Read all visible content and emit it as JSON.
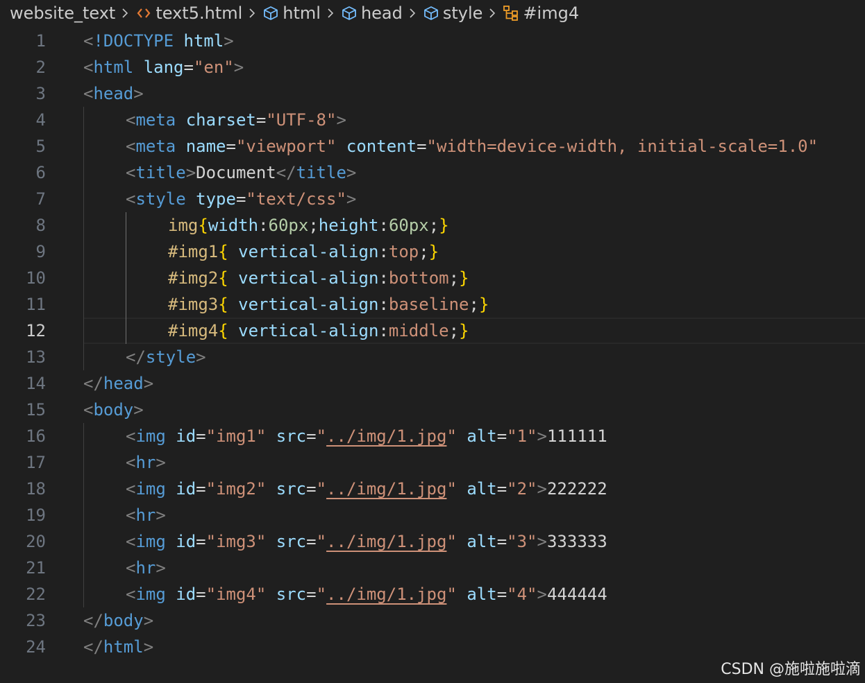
{
  "breadcrumb": [
    {
      "label": "website_text",
      "icon": "none"
    },
    {
      "label": "text5.html",
      "icon": "html-file-icon"
    },
    {
      "label": "html",
      "icon": "cube-icon"
    },
    {
      "label": "head",
      "icon": "cube-icon"
    },
    {
      "label": "style",
      "icon": "cube-icon"
    },
    {
      "label": "#img4",
      "icon": "css-selector-icon"
    }
  ],
  "editor": {
    "current_line": 12,
    "lines": [
      {
        "n": "1",
        "indent": 0,
        "tokens": [
          [
            "<",
            "punct"
          ],
          [
            "!DOCTYPE",
            "tag"
          ],
          [
            " ",
            "text"
          ],
          [
            "html",
            "attr"
          ],
          [
            ">",
            "punct"
          ]
        ]
      },
      {
        "n": "2",
        "indent": 0,
        "tokens": [
          [
            "<",
            "punct"
          ],
          [
            "html",
            "tag"
          ],
          [
            " ",
            "text"
          ],
          [
            "lang",
            "attr"
          ],
          [
            "=",
            "eq"
          ],
          [
            "\"en\"",
            "str"
          ],
          [
            ">",
            "punct"
          ]
        ]
      },
      {
        "n": "3",
        "indent": 0,
        "tokens": [
          [
            "<",
            "punct"
          ],
          [
            "head",
            "tag"
          ],
          [
            ">",
            "punct"
          ]
        ]
      },
      {
        "n": "4",
        "indent": 1,
        "tokens": [
          [
            "<",
            "punct"
          ],
          [
            "meta",
            "tag"
          ],
          [
            " ",
            "text"
          ],
          [
            "charset",
            "attr"
          ],
          [
            "=",
            "eq"
          ],
          [
            "\"UTF-8\"",
            "str"
          ],
          [
            ">",
            "punct"
          ]
        ]
      },
      {
        "n": "5",
        "indent": 1,
        "tokens": [
          [
            "<",
            "punct"
          ],
          [
            "meta",
            "tag"
          ],
          [
            " ",
            "text"
          ],
          [
            "name",
            "attr"
          ],
          [
            "=",
            "eq"
          ],
          [
            "\"viewport\"",
            "str"
          ],
          [
            " ",
            "text"
          ],
          [
            "content",
            "attr"
          ],
          [
            "=",
            "eq"
          ],
          [
            "\"width=device-width, initial-scale=1.0\"",
            "str"
          ]
        ]
      },
      {
        "n": "6",
        "indent": 1,
        "tokens": [
          [
            "<",
            "punct"
          ],
          [
            "title",
            "tag"
          ],
          [
            ">",
            "punct"
          ],
          [
            "Document",
            "text"
          ],
          [
            "</",
            "punct"
          ],
          [
            "title",
            "tag"
          ],
          [
            ">",
            "punct"
          ]
        ]
      },
      {
        "n": "7",
        "indent": 1,
        "tokens": [
          [
            "<",
            "punct"
          ],
          [
            "style",
            "tag"
          ],
          [
            " ",
            "text"
          ],
          [
            "type",
            "attr"
          ],
          [
            "=",
            "eq"
          ],
          [
            "\"text/css\"",
            "str"
          ],
          [
            ">",
            "punct"
          ]
        ]
      },
      {
        "n": "8",
        "indent": 2,
        "tokens": [
          [
            "img",
            "sel"
          ],
          [
            "{",
            "brace"
          ],
          [
            "width",
            "prop"
          ],
          [
            ":",
            "text"
          ],
          [
            "60",
            "num"
          ],
          [
            "px",
            "unit"
          ],
          [
            ";",
            "text"
          ],
          [
            "height",
            "prop"
          ],
          [
            ":",
            "text"
          ],
          [
            "60",
            "num"
          ],
          [
            "px",
            "unit"
          ],
          [
            ";",
            "text"
          ],
          [
            "}",
            "brace"
          ]
        ]
      },
      {
        "n": "9",
        "indent": 2,
        "tokens": [
          [
            "#img1",
            "sel"
          ],
          [
            "{",
            "brace"
          ],
          [
            " ",
            "text"
          ],
          [
            "vertical-align",
            "prop"
          ],
          [
            ":",
            "text"
          ],
          [
            "top",
            "kw"
          ],
          [
            ";",
            "text"
          ],
          [
            "}",
            "brace"
          ]
        ]
      },
      {
        "n": "10",
        "indent": 2,
        "tokens": [
          [
            "#img2",
            "sel"
          ],
          [
            "{",
            "brace"
          ],
          [
            " ",
            "text"
          ],
          [
            "vertical-align",
            "prop"
          ],
          [
            ":",
            "text"
          ],
          [
            "bottom",
            "kw"
          ],
          [
            ";",
            "text"
          ],
          [
            "}",
            "brace"
          ]
        ]
      },
      {
        "n": "11",
        "indent": 2,
        "tokens": [
          [
            "#img3",
            "sel"
          ],
          [
            "{",
            "brace"
          ],
          [
            " ",
            "text"
          ],
          [
            "vertical-align",
            "prop"
          ],
          [
            ":",
            "text"
          ],
          [
            "baseline",
            "kw"
          ],
          [
            ";",
            "text"
          ],
          [
            "}",
            "brace"
          ]
        ]
      },
      {
        "n": "12",
        "indent": 2,
        "tokens": [
          [
            "#img4",
            "sel"
          ],
          [
            "{",
            "brace"
          ],
          [
            " ",
            "text"
          ],
          [
            "vertical-align",
            "prop"
          ],
          [
            ":",
            "text"
          ],
          [
            "middle",
            "kw"
          ],
          [
            ";",
            "text"
          ],
          [
            "}",
            "brace"
          ]
        ]
      },
      {
        "n": "13",
        "indent": 1,
        "tokens": [
          [
            "</",
            "punct"
          ],
          [
            "style",
            "tag"
          ],
          [
            ">",
            "punct"
          ]
        ]
      },
      {
        "n": "14",
        "indent": 0,
        "tokens": [
          [
            "</",
            "punct"
          ],
          [
            "head",
            "tag"
          ],
          [
            ">",
            "punct"
          ]
        ]
      },
      {
        "n": "15",
        "indent": 0,
        "tokens": [
          [
            "<",
            "punct"
          ],
          [
            "body",
            "tag"
          ],
          [
            ">",
            "punct"
          ]
        ]
      },
      {
        "n": "16",
        "indent": 1,
        "tokens": [
          [
            "<",
            "punct"
          ],
          [
            "img",
            "tag"
          ],
          [
            " ",
            "text"
          ],
          [
            "id",
            "attr"
          ],
          [
            "=",
            "eq"
          ],
          [
            "\"img1\"",
            "str"
          ],
          [
            " ",
            "text"
          ],
          [
            "src",
            "attr"
          ],
          [
            "=",
            "eq"
          ],
          [
            "\"",
            "str"
          ],
          [
            "../img/1.jpg",
            "link"
          ],
          [
            "\"",
            "str"
          ],
          [
            " ",
            "text"
          ],
          [
            "alt",
            "attr"
          ],
          [
            "=",
            "eq"
          ],
          [
            "\"1\"",
            "str"
          ],
          [
            ">",
            "punct"
          ],
          [
            "111111",
            "text"
          ]
        ]
      },
      {
        "n": "17",
        "indent": 1,
        "tokens": [
          [
            "<",
            "punct"
          ],
          [
            "hr",
            "tag"
          ],
          [
            ">",
            "punct"
          ]
        ]
      },
      {
        "n": "18",
        "indent": 1,
        "tokens": [
          [
            "<",
            "punct"
          ],
          [
            "img",
            "tag"
          ],
          [
            " ",
            "text"
          ],
          [
            "id",
            "attr"
          ],
          [
            "=",
            "eq"
          ],
          [
            "\"img2\"",
            "str"
          ],
          [
            " ",
            "text"
          ],
          [
            "src",
            "attr"
          ],
          [
            "=",
            "eq"
          ],
          [
            "\"",
            "str"
          ],
          [
            "../img/1.jpg",
            "link"
          ],
          [
            "\"",
            "str"
          ],
          [
            " ",
            "text"
          ],
          [
            "alt",
            "attr"
          ],
          [
            "=",
            "eq"
          ],
          [
            "\"2\"",
            "str"
          ],
          [
            ">",
            "punct"
          ],
          [
            "222222",
            "text"
          ]
        ]
      },
      {
        "n": "19",
        "indent": 1,
        "tokens": [
          [
            "<",
            "punct"
          ],
          [
            "hr",
            "tag"
          ],
          [
            ">",
            "punct"
          ]
        ]
      },
      {
        "n": "20",
        "indent": 1,
        "tokens": [
          [
            "<",
            "punct"
          ],
          [
            "img",
            "tag"
          ],
          [
            " ",
            "text"
          ],
          [
            "id",
            "attr"
          ],
          [
            "=",
            "eq"
          ],
          [
            "\"img3\"",
            "str"
          ],
          [
            " ",
            "text"
          ],
          [
            "src",
            "attr"
          ],
          [
            "=",
            "eq"
          ],
          [
            "\"",
            "str"
          ],
          [
            "../img/1.jpg",
            "link"
          ],
          [
            "\"",
            "str"
          ],
          [
            " ",
            "text"
          ],
          [
            "alt",
            "attr"
          ],
          [
            "=",
            "eq"
          ],
          [
            "\"3\"",
            "str"
          ],
          [
            ">",
            "punct"
          ],
          [
            "333333",
            "text"
          ]
        ]
      },
      {
        "n": "21",
        "indent": 1,
        "tokens": [
          [
            "<",
            "punct"
          ],
          [
            "hr",
            "tag"
          ],
          [
            ">",
            "punct"
          ]
        ]
      },
      {
        "n": "22",
        "indent": 1,
        "tokens": [
          [
            "<",
            "punct"
          ],
          [
            "img",
            "tag"
          ],
          [
            " ",
            "text"
          ],
          [
            "id",
            "attr"
          ],
          [
            "=",
            "eq"
          ],
          [
            "\"img4\"",
            "str"
          ],
          [
            " ",
            "text"
          ],
          [
            "src",
            "attr"
          ],
          [
            "=",
            "eq"
          ],
          [
            "\"",
            "str"
          ],
          [
            "../img/1.jpg",
            "link"
          ],
          [
            "\"",
            "str"
          ],
          [
            " ",
            "text"
          ],
          [
            "alt",
            "attr"
          ],
          [
            "=",
            "eq"
          ],
          [
            "\"4\"",
            "str"
          ],
          [
            ">",
            "punct"
          ],
          [
            "444444",
            "text"
          ]
        ]
      },
      {
        "n": "23",
        "indent": 0,
        "tokens": [
          [
            "</",
            "punct"
          ],
          [
            "body",
            "tag"
          ],
          [
            ">",
            "punct"
          ]
        ]
      },
      {
        "n": "24",
        "indent": 0,
        "tokens": [
          [
            "</",
            "punct"
          ],
          [
            "html",
            "tag"
          ],
          [
            ">",
            "punct"
          ]
        ]
      }
    ]
  },
  "watermark": "CSDN @施啦施啦滴",
  "colors": {
    "background": "#1f1f1f",
    "tag": "#569cd6",
    "attribute": "#9cdcfe",
    "string": "#ce9178",
    "selector": "#d7ba7d",
    "number": "#b5cea8",
    "bracket": "#ffd700",
    "punctuation": "#808080",
    "line_number": "#6e7681"
  }
}
